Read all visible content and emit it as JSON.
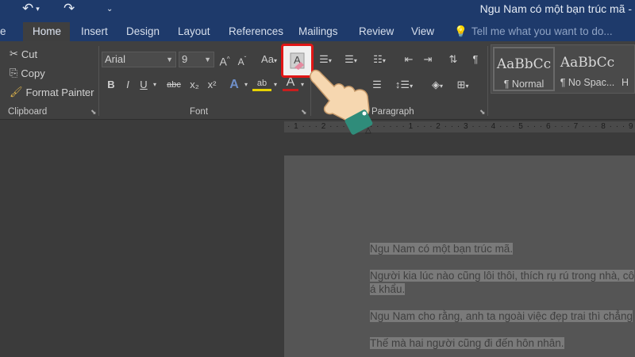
{
  "title_bar": {
    "undo_icon": "undo-icon",
    "redo_icon": "redo-icon",
    "document_title": "Ngu Nam có một bạn trúc mã -"
  },
  "tabs": [
    {
      "label": "Home",
      "active": true
    },
    {
      "label": "Insert"
    },
    {
      "label": "Design"
    },
    {
      "label": "Layout"
    },
    {
      "label": "References"
    },
    {
      "label": "Mailings"
    },
    {
      "label": "Review"
    },
    {
      "label": "View"
    }
  ],
  "tell_me": "Tell me what you want to do...",
  "clipboard": {
    "cut": "Cut",
    "copy": "Copy",
    "format_painter": "Format Painter",
    "group_label": "Clipboard"
  },
  "font": {
    "family": "Arial",
    "size": "9",
    "grow": "A",
    "shrink": "A",
    "change_case": "Aa",
    "bold": "B",
    "italic": "I",
    "underline": "U",
    "strikethrough": "abc",
    "subscript": "x₂",
    "superscript": "x²",
    "text_effects": "A",
    "highlight_label": "ab",
    "font_color": "A",
    "group_label": "Font"
  },
  "paragraph": {
    "group_label": "Paragraph",
    "show_marks": "¶"
  },
  "styles": [
    {
      "preview": "AaBbCc",
      "name": "¶ Normal"
    },
    {
      "preview": "AaBbCc",
      "name": "¶ No Spac..."
    },
    {
      "preview": "",
      "name": "H"
    }
  ],
  "ruler_text": "· 1 · · · 2 · · · 1 · · · · · · · · 1 · · · 2 · · · 3 · · · 4 · · · 5 · · · 6 · · · 7 · · · 8 · · · 9 · ·",
  "document": {
    "paragraphs": [
      {
        "lines": [
          "Ngu Nam có một bạn trúc mã."
        ]
      },
      {
        "lines": [
          "Người kia lúc nào cũng lôi thôi, thích rụ rú trong nhà, cô",
          "á khẩu."
        ]
      },
      {
        "lines": [
          "Ngu Nam cho rằng, anh ta ngoài việc đẹp trai thì chẳng"
        ]
      },
      {
        "lines": [
          "Thế mà hai người cũng đi đến hôn nhân."
        ]
      }
    ]
  },
  "colors": {
    "accent": "#1e3a6b",
    "highlight_box": "#e01616",
    "font_color_bar": "#c81e1e",
    "highlight_bar": "#e6d200"
  }
}
